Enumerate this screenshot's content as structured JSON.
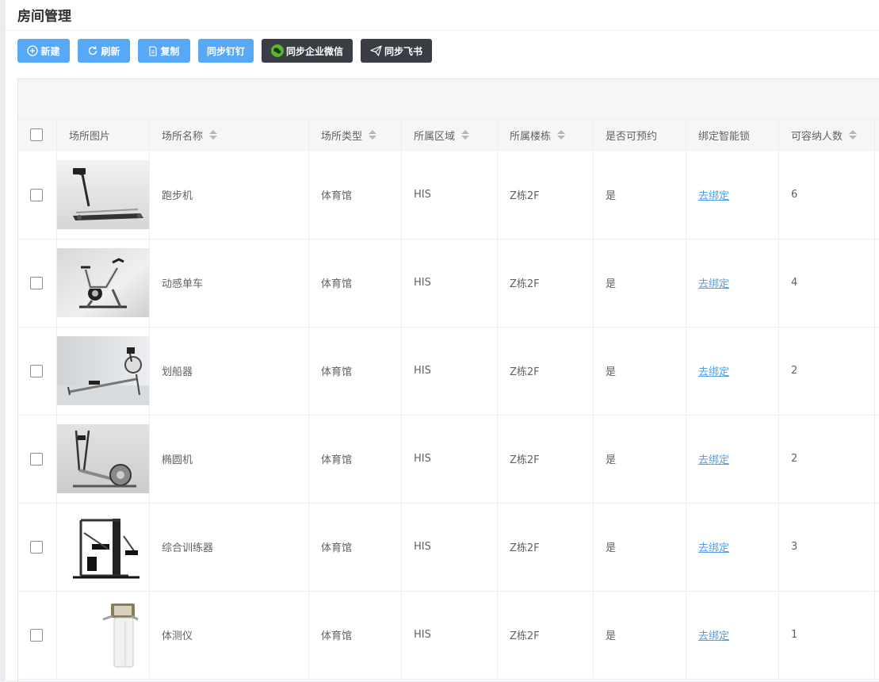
{
  "page": {
    "title": "房间管理"
  },
  "toolbar": {
    "new_label": "新建",
    "refresh_label": "刷新",
    "copy_label": "复制",
    "dingtalk_label": "同步钉钉",
    "wecom_label": "同步企业微信",
    "feishu_label": "同步飞书"
  },
  "table": {
    "headers": {
      "image": "场所图片",
      "name": "场所名称",
      "type": "场所类型",
      "area": "所属区域",
      "building": "所属楼栋",
      "bookable": "是否可预约",
      "lock": "绑定智能锁",
      "capacity": "可容纳人数"
    },
    "rows": [
      {
        "name": "跑步机",
        "type": "体育馆",
        "area": "HIS",
        "building": "Z栋2F",
        "bookable": "是",
        "lock": "去绑定",
        "capacity": "6",
        "image_icon": "treadmill-photo"
      },
      {
        "name": "动感单车",
        "type": "体育馆",
        "area": "HIS",
        "building": "Z栋2F",
        "bookable": "是",
        "lock": "去绑定",
        "capacity": "4",
        "image_icon": "spin-bike-photo"
      },
      {
        "name": "划船器",
        "type": "体育馆",
        "area": "HIS",
        "building": "Z栋2F",
        "bookable": "是",
        "lock": "去绑定",
        "capacity": "2",
        "image_icon": "rowing-machine-photo"
      },
      {
        "name": "椭圆机",
        "type": "体育馆",
        "area": "HIS",
        "building": "Z栋2F",
        "bookable": "是",
        "lock": "去绑定",
        "capacity": "2",
        "image_icon": "elliptical-photo"
      },
      {
        "name": "综合训练器",
        "type": "体育馆",
        "area": "HIS",
        "building": "Z栋2F",
        "bookable": "是",
        "lock": "去绑定",
        "capacity": "3",
        "image_icon": "home-gym-photo"
      },
      {
        "name": "体测仪",
        "type": "体育馆",
        "area": "HIS",
        "building": "Z栋2F",
        "bookable": "是",
        "lock": "去绑定",
        "capacity": "1",
        "image_icon": "body-analyzer-photo"
      }
    ]
  },
  "colors": {
    "primary": "#58a8f8",
    "dark_button": "#3a3d44",
    "link": "#4d9ff0"
  }
}
